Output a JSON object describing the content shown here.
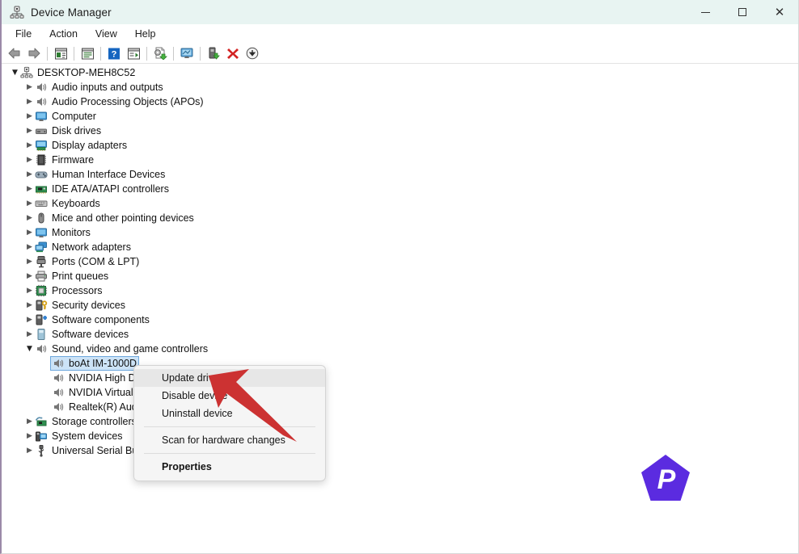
{
  "window": {
    "title": "Device Manager",
    "title_icon": "device-manager-icon",
    "titlebar_bg": "#e8f4f2",
    "controls": {
      "minimize": "minimize-icon",
      "maximize": "maximize-icon",
      "close": "close-icon"
    }
  },
  "menubar": {
    "items": [
      {
        "label": "File",
        "name": "menu-file"
      },
      {
        "label": "Action",
        "name": "menu-action"
      },
      {
        "label": "View",
        "name": "menu-view"
      },
      {
        "label": "Help",
        "name": "menu-help"
      }
    ]
  },
  "toolbar": {
    "buttons": [
      {
        "name": "back-button",
        "icon": "back-arrow-icon"
      },
      {
        "name": "forward-button",
        "icon": "forward-arrow-icon"
      },
      {
        "name": "sep-1",
        "icon": "separator"
      },
      {
        "name": "show-hide-console-tree-button",
        "icon": "console-tree-icon"
      },
      {
        "name": "sep-2",
        "icon": "separator"
      },
      {
        "name": "properties-button",
        "icon": "properties-window-icon"
      },
      {
        "name": "sep-3",
        "icon": "separator"
      },
      {
        "name": "help-button",
        "icon": "question-mark-icon"
      },
      {
        "name": "show-hide-action-pane-button",
        "icon": "action-pane-icon"
      },
      {
        "name": "sep-4",
        "icon": "separator"
      },
      {
        "name": "update-driver-button",
        "icon": "update-driver-icon"
      },
      {
        "name": "sep-5",
        "icon": "separator"
      },
      {
        "name": "scan-hardware-changes-button",
        "icon": "scan-monitor-icon"
      },
      {
        "name": "sep-6",
        "icon": "separator"
      },
      {
        "name": "enable-device-button",
        "icon": "enable-device-icon"
      },
      {
        "name": "uninstall-device-button",
        "icon": "red-x-icon"
      },
      {
        "name": "disable-device-button",
        "icon": "down-arrow-circle-icon"
      }
    ]
  },
  "tree": {
    "root": {
      "label": "DESKTOP-MEH8C52",
      "icon": "computer-root-icon",
      "expanded": true
    },
    "items": [
      {
        "label": "Audio inputs and outputs",
        "icon": "speaker-icon",
        "expanded": false,
        "depth": 1
      },
      {
        "label": "Audio Processing Objects (APOs)",
        "icon": "speaker-icon",
        "expanded": false,
        "depth": 1
      },
      {
        "label": "Computer",
        "icon": "monitor-icon",
        "expanded": false,
        "depth": 1
      },
      {
        "label": "Disk drives",
        "icon": "disk-drive-icon",
        "expanded": false,
        "depth": 1
      },
      {
        "label": "Display adapters",
        "icon": "display-adapter-icon",
        "expanded": false,
        "depth": 1
      },
      {
        "label": "Firmware",
        "icon": "firmware-chip-icon",
        "expanded": false,
        "depth": 1
      },
      {
        "label": "Human Interface Devices",
        "icon": "gamepad-icon",
        "expanded": false,
        "depth": 1
      },
      {
        "label": "IDE ATA/ATAPI controllers",
        "icon": "ide-controller-icon",
        "expanded": false,
        "depth": 1
      },
      {
        "label": "Keyboards",
        "icon": "keyboard-icon",
        "expanded": false,
        "depth": 1
      },
      {
        "label": "Mice and other pointing devices",
        "icon": "mouse-icon",
        "expanded": false,
        "depth": 1
      },
      {
        "label": "Monitors",
        "icon": "monitor-icon",
        "expanded": false,
        "depth": 1
      },
      {
        "label": "Network adapters",
        "icon": "network-adapter-icon",
        "expanded": false,
        "depth": 1
      },
      {
        "label": "Ports (COM & LPT)",
        "icon": "port-connector-icon",
        "expanded": false,
        "depth": 1
      },
      {
        "label": "Print queues",
        "icon": "printer-icon",
        "expanded": false,
        "depth": 1
      },
      {
        "label": "Processors",
        "icon": "processor-icon",
        "expanded": false,
        "depth": 1
      },
      {
        "label": "Security devices",
        "icon": "security-key-icon",
        "expanded": false,
        "depth": 1
      },
      {
        "label": "Software components",
        "icon": "software-component-icon",
        "expanded": false,
        "depth": 1
      },
      {
        "label": "Software devices",
        "icon": "software-device-icon",
        "expanded": false,
        "depth": 1
      },
      {
        "label": "Sound, video and game controllers",
        "icon": "speaker-icon",
        "expanded": true,
        "depth": 1
      },
      {
        "label": "boAt IM-1000D",
        "icon": "speaker-icon",
        "leaf": true,
        "selected": true,
        "depth": 2
      },
      {
        "label": "NVIDIA High D",
        "icon": "speaker-icon",
        "leaf": true,
        "depth": 2
      },
      {
        "label": "NVIDIA Virtual",
        "icon": "speaker-icon",
        "leaf": true,
        "depth": 2
      },
      {
        "label": "Realtek(R) Aud",
        "icon": "speaker-icon",
        "leaf": true,
        "depth": 2
      },
      {
        "label": "Storage controllers",
        "icon": "storage-controller-icon",
        "expanded": false,
        "depth": 1
      },
      {
        "label": "System devices",
        "icon": "system-device-icon",
        "expanded": false,
        "depth": 1
      },
      {
        "label": "Universal Serial Bu",
        "icon": "usb-icon",
        "expanded": false,
        "depth": 1
      }
    ]
  },
  "context_menu": {
    "items": [
      {
        "label": "Update driver",
        "name": "ctx-update-driver",
        "highlighted": true,
        "bold": false
      },
      {
        "label": "Disable device",
        "name": "ctx-disable-device",
        "highlighted": false,
        "bold": false
      },
      {
        "label": "Uninstall device",
        "name": "ctx-uninstall-device",
        "highlighted": false,
        "bold": false
      },
      {
        "label": "Scan for hardware changes",
        "name": "ctx-scan-hardware-changes",
        "highlighted": false,
        "bold": false
      },
      {
        "label": "Properties",
        "name": "ctx-properties",
        "highlighted": false,
        "bold": true
      }
    ]
  },
  "annotation": {
    "arrow": {
      "name": "red-pointer-arrow",
      "color": "#d13030"
    }
  },
  "watermark": {
    "name": "purple-pentagon-p-logo",
    "letter": "P",
    "color": "#5b2be0"
  }
}
